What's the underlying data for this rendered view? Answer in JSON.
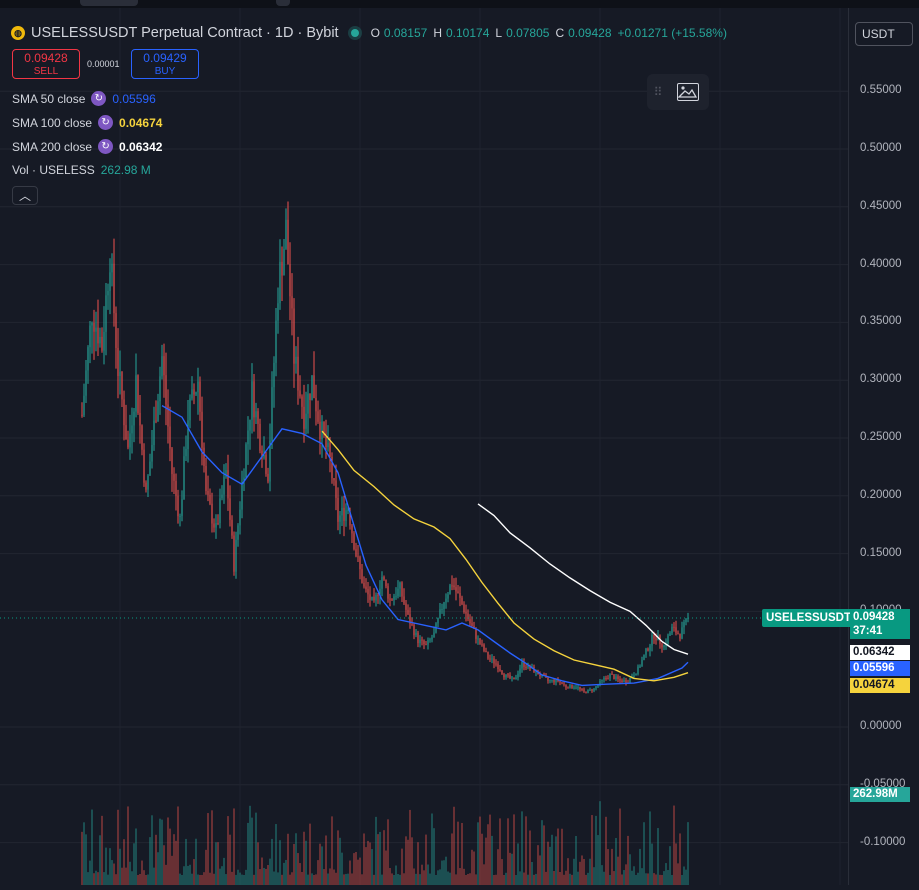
{
  "header": {
    "title": "USELESSUSDT Perpetual Contract · 1D · Bybit",
    "logo_icon": "bybit-coin-icon",
    "ohlc": {
      "o_label": "O",
      "o": "0.08157",
      "h_label": "H",
      "h": "0.10174",
      "l_label": "L",
      "l": "0.07805",
      "c_label": "C",
      "c": "0.09428",
      "change": "+0.01271 (+15.58%)"
    },
    "currency": "USDT"
  },
  "trade": {
    "sell_price": "0.09428",
    "sell_label": "SELL",
    "spread": "0.00001",
    "buy_price": "0.09429",
    "buy_label": "BUY"
  },
  "indicators": [
    {
      "label": "SMA 50 close",
      "value": "0.05596",
      "color": "#2962ff"
    },
    {
      "label": "SMA 100 close",
      "value": "0.04674",
      "color": "#f5d33d"
    },
    {
      "label": "SMA 200 close",
      "value": "0.06342",
      "color": "#ffffff"
    },
    {
      "label": "Vol · USELESS",
      "value": "262.98 M",
      "color": "#26a69a"
    }
  ],
  "axis": {
    "ticks": [
      "0.55000",
      "0.50000",
      "0.45000",
      "0.40000",
      "0.35000",
      "0.30000",
      "0.25000",
      "0.20000",
      "0.15000",
      "0.10000",
      "0.00000",
      "-0.05000",
      "-0.10000"
    ],
    "last_symbol": "USELESSUSDT.P",
    "last_price": "0.09428",
    "countdown": "37:41",
    "sma200_tag": "0.06342",
    "sma50_tag": "0.05596",
    "sma100_tag": "0.04674",
    "volume_tag": "262.98M"
  },
  "colors": {
    "up": "#26a69a",
    "down": "#ef5350",
    "sma50": "#2962ff",
    "sma100": "#f5d33d",
    "sma200": "#ffffff",
    "background": "#161a25"
  },
  "chart_data": {
    "type": "line",
    "title": "USELESSUSDT Perpetual Contract · 1D · Bybit",
    "ylim": [
      -0.11,
      0.58
    ],
    "price_path": [
      [
        0,
        0.27
      ],
      [
        5,
        0.36
      ],
      [
        10,
        0.33
      ],
      [
        14,
        0.41
      ],
      [
        18,
        0.31
      ],
      [
        23,
        0.24
      ],
      [
        27,
        0.3
      ],
      [
        32,
        0.2
      ],
      [
        36,
        0.26
      ],
      [
        40,
        0.32
      ],
      [
        45,
        0.22
      ],
      [
        49,
        0.18
      ],
      [
        53,
        0.27
      ],
      [
        58,
        0.3
      ],
      [
        62,
        0.2
      ],
      [
        67,
        0.17
      ],
      [
        72,
        0.22
      ],
      [
        76,
        0.14
      ],
      [
        80,
        0.21
      ],
      [
        85,
        0.29
      ],
      [
        89,
        0.25
      ],
      [
        93,
        0.22
      ],
      [
        98,
        0.38
      ],
      [
        102,
        0.43
      ],
      [
        106,
        0.32
      ],
      [
        111,
        0.27
      ],
      [
        115,
        0.3
      ],
      [
        119,
        0.26
      ],
      [
        124,
        0.23
      ],
      [
        128,
        0.18
      ],
      [
        133,
        0.19
      ],
      [
        137,
        0.15
      ],
      [
        141,
        0.12
      ],
      [
        146,
        0.105
      ],
      [
        150,
        0.13
      ],
      [
        154,
        0.11
      ],
      [
        159,
        0.12
      ],
      [
        163,
        0.095
      ],
      [
        168,
        0.075
      ],
      [
        172,
        0.07
      ],
      [
        176,
        0.08
      ],
      [
        181,
        0.11
      ],
      [
        185,
        0.125
      ],
      [
        189,
        0.11
      ],
      [
        194,
        0.09
      ],
      [
        198,
        0.075
      ],
      [
        203,
        0.06
      ],
      [
        207,
        0.055
      ],
      [
        211,
        0.045
      ],
      [
        216,
        0.04
      ],
      [
        220,
        0.055
      ],
      [
        225,
        0.05
      ],
      [
        229,
        0.045
      ],
      [
        233,
        0.04
      ],
      [
        238,
        0.04
      ],
      [
        242,
        0.035
      ],
      [
        247,
        0.035
      ],
      [
        251,
        0.03
      ],
      [
        256,
        0.033
      ],
      [
        260,
        0.04
      ],
      [
        264,
        0.045
      ],
      [
        269,
        0.04
      ],
      [
        273,
        0.04
      ],
      [
        278,
        0.05
      ],
      [
        282,
        0.065
      ],
      [
        286,
        0.08
      ],
      [
        291,
        0.07
      ],
      [
        295,
        0.085
      ],
      [
        299,
        0.08
      ],
      [
        303,
        0.094
      ]
    ],
    "series": [
      {
        "name": "SMA 50 close",
        "points": [
          [
            40,
            0.278
          ],
          [
            50,
            0.268
          ],
          [
            60,
            0.238
          ],
          [
            70,
            0.22
          ],
          [
            80,
            0.21
          ],
          [
            90,
            0.234
          ],
          [
            100,
            0.258
          ],
          [
            110,
            0.254
          ],
          [
            120,
            0.245
          ],
          [
            128,
            0.22
          ],
          [
            135,
            0.18
          ],
          [
            142,
            0.14
          ],
          [
            150,
            0.11
          ],
          [
            158,
            0.093
          ],
          [
            166,
            0.09
          ],
          [
            174,
            0.087
          ],
          [
            182,
            0.084
          ],
          [
            190,
            0.09
          ],
          [
            198,
            0.084
          ],
          [
            206,
            0.074
          ],
          [
            214,
            0.064
          ],
          [
            222,
            0.055
          ],
          [
            230,
            0.045
          ],
          [
            240,
            0.04
          ],
          [
            250,
            0.036
          ],
          [
            262,
            0.037
          ],
          [
            276,
            0.038
          ],
          [
            288,
            0.042
          ],
          [
            300,
            0.051
          ],
          [
            303,
            0.056
          ]
        ]
      },
      {
        "name": "SMA 100 close",
        "points": [
          [
            120,
            0.256
          ],
          [
            128,
            0.24
          ],
          [
            136,
            0.222
          ],
          [
            146,
            0.208
          ],
          [
            156,
            0.192
          ],
          [
            166,
            0.18
          ],
          [
            176,
            0.173
          ],
          [
            184,
            0.163
          ],
          [
            192,
            0.145
          ],
          [
            200,
            0.125
          ],
          [
            208,
            0.107
          ],
          [
            216,
            0.09
          ],
          [
            226,
            0.076
          ],
          [
            236,
            0.066
          ],
          [
            246,
            0.058
          ],
          [
            256,
            0.054
          ],
          [
            266,
            0.05
          ],
          [
            276,
            0.042
          ],
          [
            286,
            0.04
          ],
          [
            296,
            0.043
          ],
          [
            303,
            0.047
          ]
        ]
      },
      {
        "name": "SMA 200 close",
        "points": [
          [
            198,
            0.193
          ],
          [
            206,
            0.183
          ],
          [
            214,
            0.168
          ],
          [
            224,
            0.155
          ],
          [
            234,
            0.141
          ],
          [
            244,
            0.129
          ],
          [
            254,
            0.118
          ],
          [
            264,
            0.108
          ],
          [
            274,
            0.1
          ],
          [
            282,
            0.088
          ],
          [
            290,
            0.074
          ],
          [
            296,
            0.067
          ],
          [
            303,
            0.063
          ]
        ]
      }
    ],
    "volume_bars": "~300 daily bars, values not labeled; last volume 262.98M"
  }
}
